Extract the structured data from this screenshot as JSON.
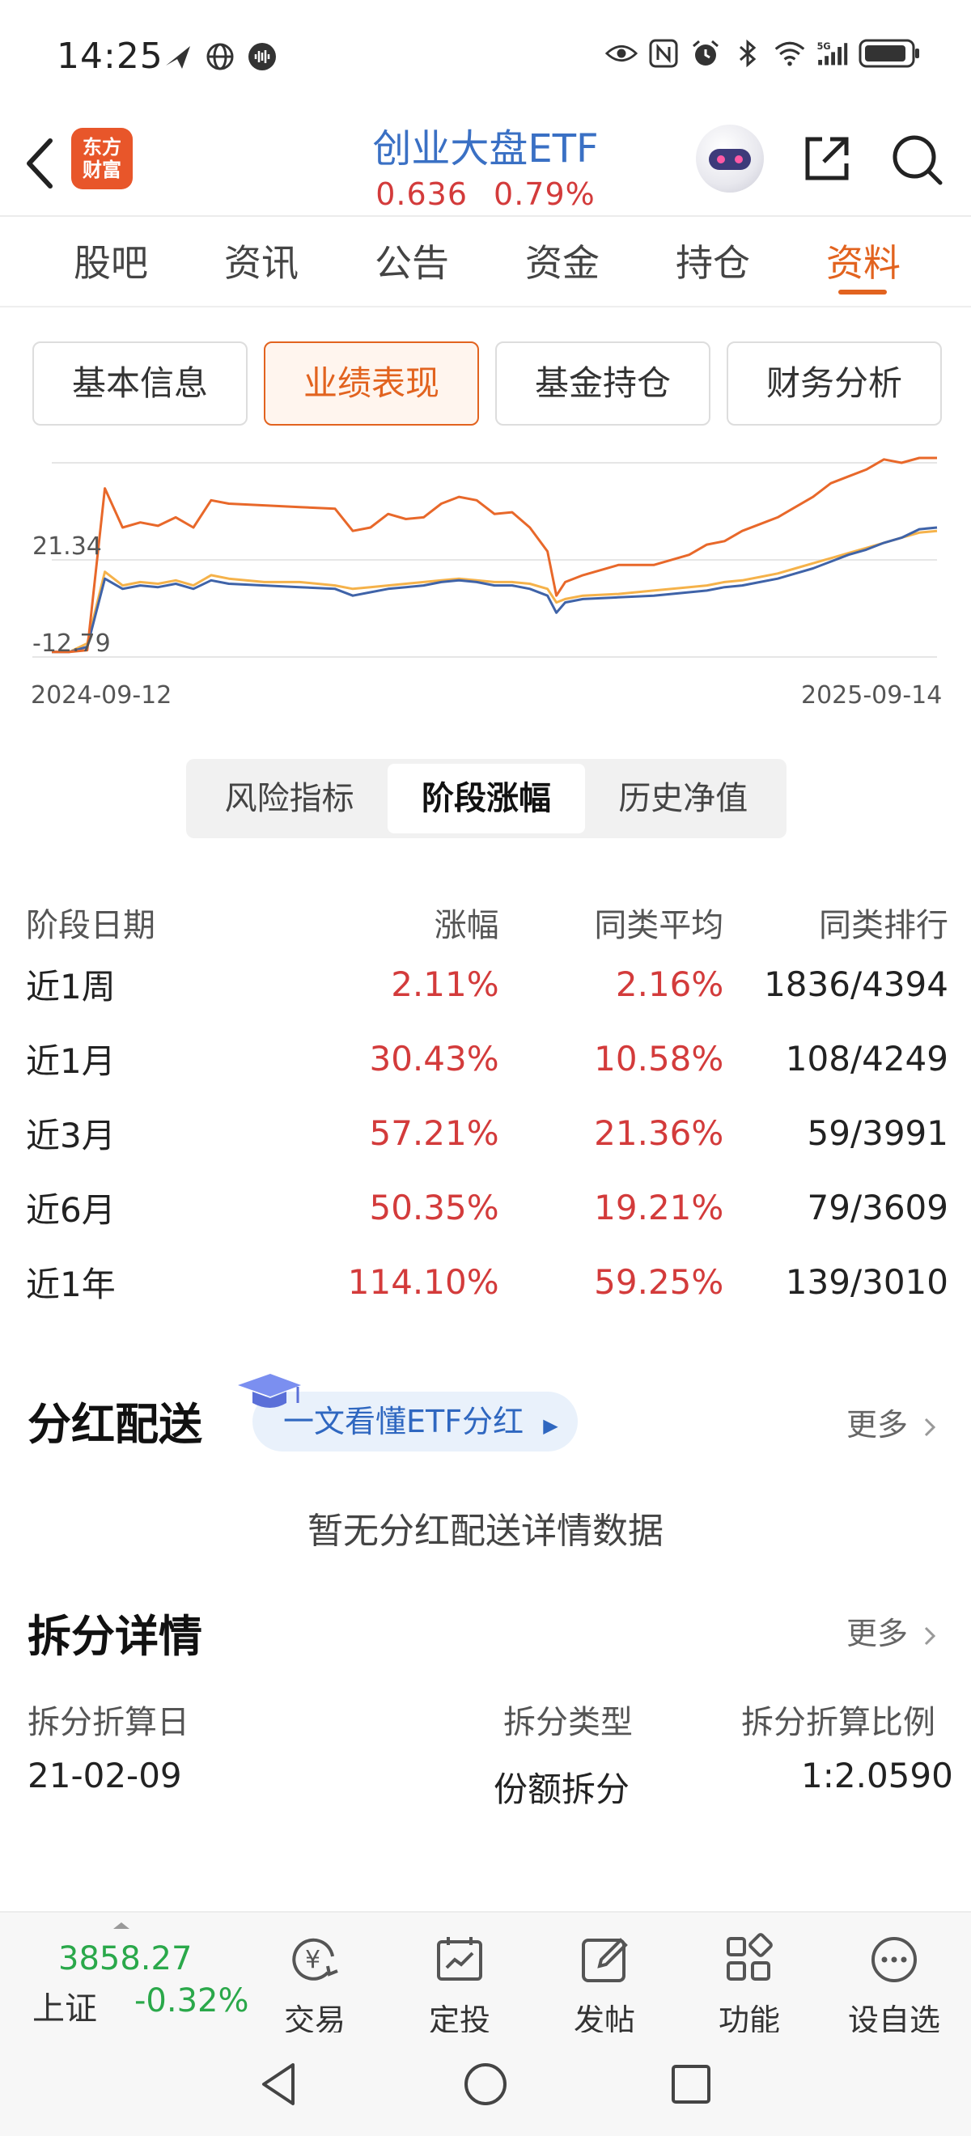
{
  "status_bar": {
    "time": "14:25",
    "left_icons": [
      "paper-plane-icon",
      "globe-icon",
      "voice-icon"
    ],
    "right_icons": [
      "eye-icon",
      "nfc-icon",
      "alarm-icon",
      "bluetooth-icon",
      "wifi-icon",
      "signal-5g-icon",
      "battery-icon"
    ]
  },
  "header": {
    "logo_text": "东方财富",
    "title": "创业大盘ETF",
    "price": "0.636",
    "change": "0.79%"
  },
  "main_tabs": [
    {
      "label": "股吧"
    },
    {
      "label": "资讯"
    },
    {
      "label": "公告"
    },
    {
      "label": "资金"
    },
    {
      "label": "持仓"
    },
    {
      "label": "资料"
    }
  ],
  "sub_tabs": [
    {
      "label": "基本信息"
    },
    {
      "label": "业绩表现"
    },
    {
      "label": "基金持仓"
    },
    {
      "label": "财务分析"
    }
  ],
  "chart_data": {
    "type": "line",
    "y_ticks": [
      "21.34",
      "-12.79"
    ],
    "x_ticks": [
      "2024-09-12",
      "2025-09-14"
    ],
    "colors": {
      "fund": "#e8682a",
      "peer_average": "#f5b24a",
      "index": "#3f63a8"
    },
    "x_range": [
      0,
      100
    ],
    "ylim": [
      -14,
      100
    ],
    "series": [
      {
        "key": "fund",
        "x": [
          0,
          2,
          4,
          6,
          8,
          10,
          12,
          14,
          16,
          18,
          20,
          24,
          28,
          32,
          34,
          36,
          38,
          40,
          42,
          44,
          46,
          48,
          50,
          52,
          54,
          56,
          57,
          58,
          60,
          64,
          68,
          72,
          74,
          76,
          78,
          80,
          82,
          84,
          86,
          88,
          90,
          92,
          94,
          96,
          98,
          100
        ],
        "values": [
          -11,
          -11,
          -10,
          85,
          62,
          65,
          63,
          68,
          62,
          78,
          76,
          75,
          74,
          73,
          60,
          62,
          70,
          67,
          68,
          76,
          80,
          78,
          70,
          71,
          62,
          48,
          22,
          30,
          34,
          40,
          40,
          46,
          52,
          54,
          60,
          64,
          68,
          74,
          80,
          88,
          92,
          96,
          102,
          100,
          103,
          104
        ]
      },
      {
        "key": "peer_average",
        "x": [
          0,
          2,
          4,
          6,
          8,
          10,
          12,
          14,
          16,
          18,
          20,
          24,
          28,
          32,
          34,
          36,
          38,
          40,
          42,
          44,
          46,
          48,
          50,
          52,
          54,
          56,
          57,
          58,
          60,
          64,
          68,
          72,
          74,
          76,
          78,
          80,
          82,
          84,
          86,
          88,
          90,
          92,
          94,
          96,
          98,
          100
        ],
        "values": [
          -11,
          -11,
          -6,
          36,
          28,
          30,
          29,
          31,
          28,
          34,
          32,
          30,
          30,
          28,
          26,
          27,
          28,
          29,
          30,
          31,
          32,
          31,
          30,
          30,
          29,
          26,
          18,
          20,
          22,
          23,
          25,
          27,
          28,
          30,
          31,
          33,
          35,
          38,
          41,
          44,
          47,
          50,
          53,
          56,
          59,
          60
        ]
      },
      {
        "key": "index",
        "x": [
          0,
          2,
          4,
          6,
          8,
          10,
          12,
          14,
          16,
          18,
          20,
          24,
          28,
          32,
          34,
          36,
          38,
          40,
          42,
          44,
          46,
          48,
          50,
          52,
          54,
          56,
          57,
          58,
          60,
          64,
          68,
          72,
          74,
          76,
          78,
          80,
          82,
          84,
          86,
          88,
          90,
          92,
          94,
          96,
          98,
          100
        ],
        "values": [
          -11,
          -11,
          -8,
          32,
          26,
          28,
          27,
          29,
          26,
          31,
          29,
          28,
          27,
          26,
          22,
          24,
          26,
          27,
          28,
          30,
          31,
          30,
          28,
          28,
          26,
          22,
          12,
          18,
          20,
          21,
          22,
          24,
          25,
          27,
          28,
          30,
          32,
          35,
          38,
          42,
          46,
          49,
          53,
          56,
          61,
          62
        ]
      }
    ]
  },
  "segmented": [
    {
      "label": "风险指标"
    },
    {
      "label": "阶段涨幅"
    },
    {
      "label": "历史净值"
    }
  ],
  "performance": {
    "headers": [
      "阶段日期",
      "涨幅",
      "同类平均",
      "同类排行"
    ],
    "rows": [
      {
        "period": "近1周",
        "change": "2.11%",
        "avg": "2.16%",
        "rank": "1836/4394"
      },
      {
        "period": "近1月",
        "change": "30.43%",
        "avg": "10.58%",
        "rank": "108/4249"
      },
      {
        "period": "近3月",
        "change": "57.21%",
        "avg": "21.36%",
        "rank": "59/3991"
      },
      {
        "period": "近6月",
        "change": "50.35%",
        "avg": "19.21%",
        "rank": "79/3609"
      },
      {
        "period": "近1年",
        "change": "114.10%",
        "avg": "59.25%",
        "rank": "139/3010"
      }
    ]
  },
  "dividend": {
    "title": "分红配送",
    "guide_link": "一文看懂ETF分红",
    "more": "更多",
    "empty": "暂无分红配送详情数据"
  },
  "split": {
    "title": "拆分详情",
    "more": "更多",
    "headers": [
      "拆分折算日",
      "拆分类型",
      "拆分折算比例"
    ],
    "date": "21-02-09",
    "type": "份额拆分",
    "ratio": "1:2.0590"
  },
  "bottom_bar": {
    "index_value": "3858.27",
    "index_name": "上证",
    "index_change": "-0.32%",
    "nav": [
      {
        "label": "交易"
      },
      {
        "label": "定投"
      },
      {
        "label": "发帖"
      },
      {
        "label": "功能"
      },
      {
        "label": "设自选"
      }
    ]
  }
}
